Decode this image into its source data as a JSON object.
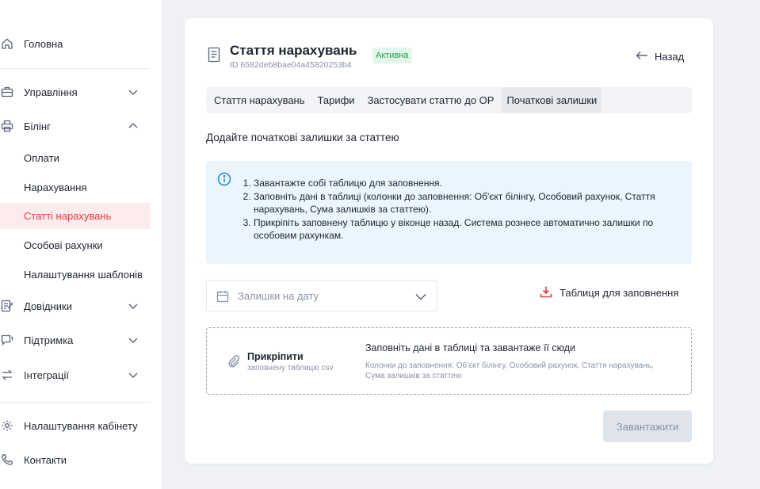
{
  "sidebar": {
    "home": "Головна",
    "management": "Управління",
    "billing": "Білінг",
    "billing_sub": [
      "Оплати",
      "Нарахування",
      "Статті нарахувань",
      "Особові рахунки",
      "Налаштування шаблонів"
    ],
    "directories": "Довідники",
    "support": "Підтримка",
    "integrations": "Інтеграції",
    "cabinet_settings": "Налаштування кабінету",
    "contacts": "Контакти"
  },
  "header": {
    "title": "Стаття нарахувань",
    "status": "Активна",
    "id_text": "ID 6582deb8bae04a45820253b4",
    "back_label": "Назад"
  },
  "tabs": [
    "Стаття нарахувань",
    "Тарифи",
    "Застосувати статтю до ОР",
    "Початкові залишки"
  ],
  "section_title": "Додайте початкові залишки за статтею",
  "info_steps": [
    "Завантажте собі таблицю для заповнення.",
    "Заповніть дані в таблиці (колонки до заповнення: Об'єкт білінгу, Особовий рахунок, Стаття нарахувань, Сума залишків за статтею).",
    "Прикріпіть заповнену таблицю у віконце назад. Система рознесе автоматично залишки по особовим рахункам."
  ],
  "date_select": {
    "placeholder": "Залишки на дату"
  },
  "template_link": "Таблиця для заповнення",
  "dropzone": {
    "attach": "Прикріпити",
    "attach_sub": "заповнену таблицю csv",
    "title": "Заповніть дані в таблиці та завантаже її сюди",
    "columns": "Колонки до заповнення: Об'єкт білінгу, Особовий рахунок, Стаття нарахувань, Сума залишків за статтею"
  },
  "upload_button": "Завантажити",
  "colors": {
    "accent": "#e53a45",
    "status_green": "#1f9e5a",
    "info_bg": "#eaf5fd"
  }
}
